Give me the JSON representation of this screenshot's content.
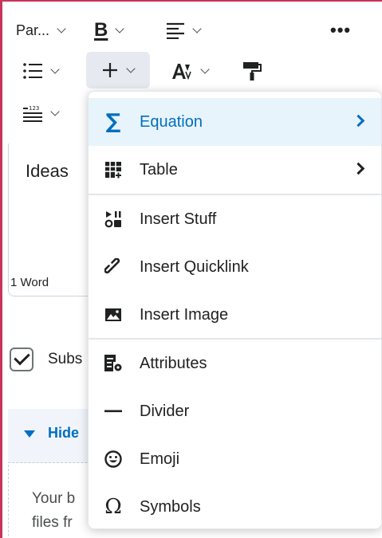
{
  "toolbar": {
    "paragraph_label": "Par...",
    "bold_label": "B",
    "more_label": "•••"
  },
  "editor": {
    "content_text": "Ideas",
    "word_count": "1 Word"
  },
  "below": {
    "checkbox_label": "Subs",
    "hide_label": "Hide",
    "drop_text_line1": "Your b",
    "drop_text_line2": "files fr"
  },
  "menu": {
    "items": [
      {
        "label": "Equation",
        "icon": "sigma-icon",
        "submenu": true,
        "highlighted": true
      },
      {
        "label": "Table",
        "icon": "table-icon",
        "submenu": true
      },
      {
        "label": "Insert Stuff",
        "icon": "insert-stuff-icon"
      },
      {
        "label": "Insert Quicklink",
        "icon": "link-icon"
      },
      {
        "label": "Insert Image",
        "icon": "image-icon"
      },
      {
        "label": "Attributes",
        "icon": "attributes-icon"
      },
      {
        "label": "Divider",
        "icon": "divider-icon"
      },
      {
        "label": "Emoji",
        "icon": "emoji-icon"
      },
      {
        "label": "Symbols",
        "icon": "omega-icon"
      }
    ]
  },
  "colors": {
    "accent": "#006fbf",
    "highlight_bg": "#e8f4fc",
    "frame_border": "#c8355b"
  }
}
